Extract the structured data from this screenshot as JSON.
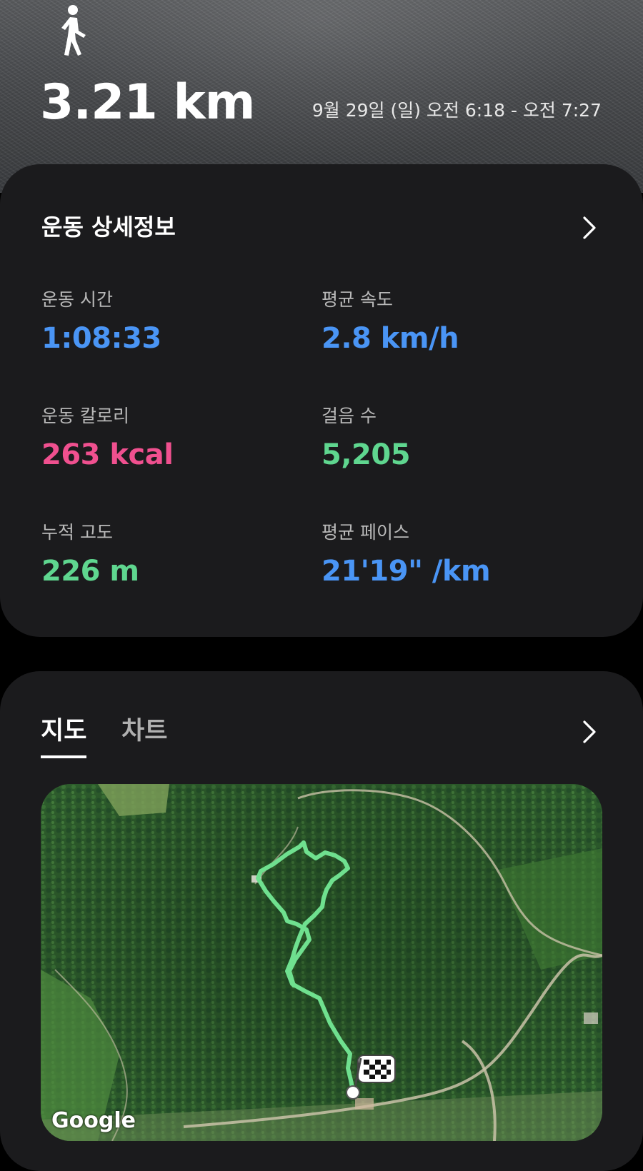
{
  "header": {
    "activity_icon": "walking-person-icon",
    "distance": "3.21 km",
    "datetime": "9월 29일 (일) 오전 6:18 - 오전 7:27"
  },
  "details": {
    "title": "운동 상세정보",
    "chevron_icon": "chevron-right-icon",
    "stats": [
      {
        "label": "운동 시간",
        "value": "1:08:33",
        "color": "#4a95f5"
      },
      {
        "label": "평균 속도",
        "value": "2.8 km/h",
        "color": "#4a95f5"
      },
      {
        "label": "운동 칼로리",
        "value": "263 kcal",
        "color": "#f0508f"
      },
      {
        "label": "걸음 수",
        "value": "5,205",
        "color": "#5fd68f"
      },
      {
        "label": "누적 고도",
        "value": "226 m",
        "color": "#5fd68f"
      },
      {
        "label": "평균 페이스",
        "value": "21'19\" /km",
        "color": "#4a95f5"
      }
    ]
  },
  "map_card": {
    "tabs": [
      {
        "label": "지도",
        "active": true
      },
      {
        "label": "차트",
        "active": false
      }
    ],
    "chevron_icon": "chevron-right-icon",
    "map": {
      "route_color": "#6fe08f",
      "start_marker_icon": "start-point-icon",
      "finish_marker_icon": "checkered-flag-icon",
      "attribution": "Google"
    }
  },
  "colors": {
    "card_bg": "#1b1b1d",
    "accent_blue": "#4a95f5",
    "accent_pink": "#f0508f",
    "accent_green": "#5fd68f"
  }
}
